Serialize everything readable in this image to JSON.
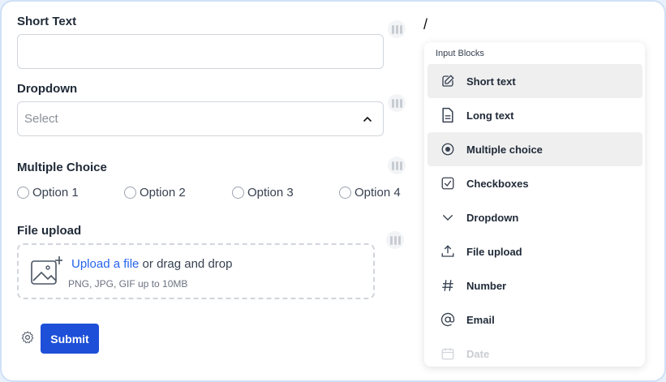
{
  "form": {
    "short_text": {
      "label": "Short Text",
      "value": ""
    },
    "dropdown": {
      "label": "Dropdown",
      "placeholder": "Select"
    },
    "multiple_choice": {
      "label": "Multiple Choice",
      "options": [
        "Option 1",
        "Option 2",
        "Option 3",
        "Option 4"
      ]
    },
    "file_upload": {
      "label": "File upload",
      "link_text": "Upload a file",
      "rest_text": " or drag and drop",
      "hint": "PNG, JPG, GIF up to 10MB"
    },
    "submit_label": "Submit"
  },
  "menu": {
    "title": "Input Blocks",
    "items": [
      {
        "label": "Short text",
        "icon": "pencil-square-icon",
        "active": true
      },
      {
        "label": "Long text",
        "icon": "document-icon",
        "active": false
      },
      {
        "label": "Multiple choice",
        "icon": "radio-icon",
        "active": true
      },
      {
        "label": "Checkboxes",
        "icon": "checkbox-icon",
        "active": false
      },
      {
        "label": "Dropdown",
        "icon": "chevron-down-icon",
        "active": false
      },
      {
        "label": "File upload",
        "icon": "upload-icon",
        "active": false
      },
      {
        "label": "Number",
        "icon": "hash-icon",
        "active": false
      },
      {
        "label": "Email",
        "icon": "at-icon",
        "active": false
      },
      {
        "label": "Date",
        "icon": "calendar-icon",
        "active": false,
        "faded": true
      }
    ]
  },
  "cursor_text": "/"
}
